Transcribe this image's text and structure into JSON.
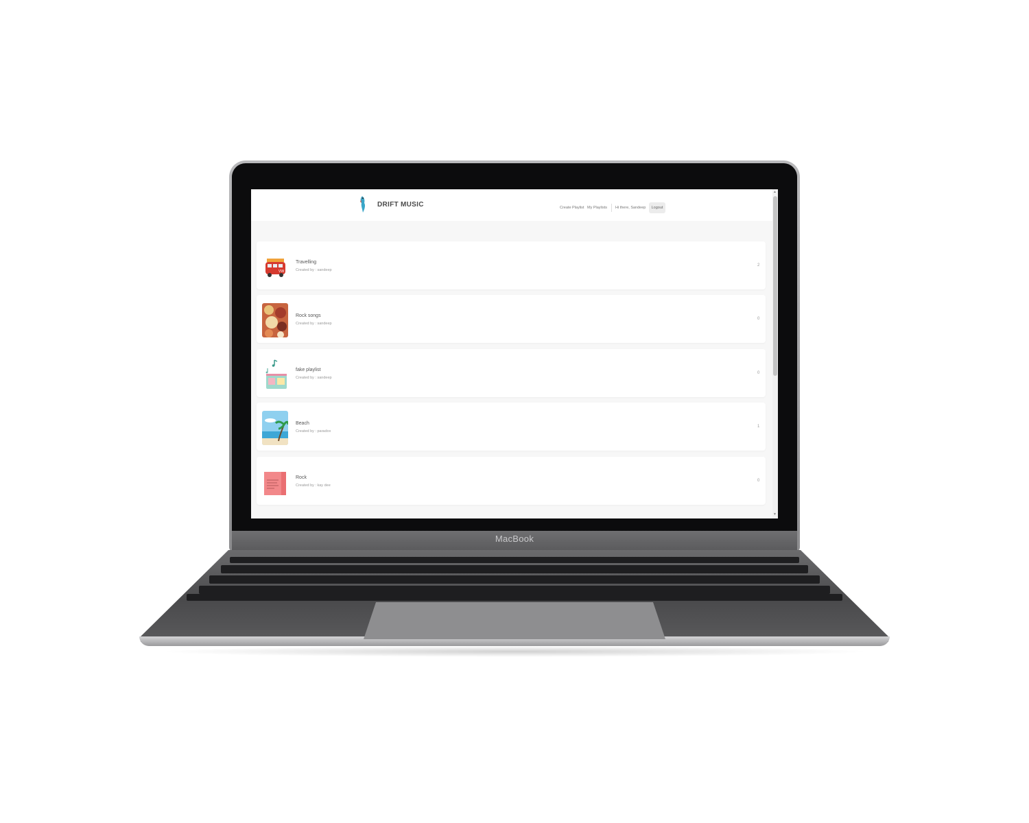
{
  "device": {
    "brand_label": "MacBook"
  },
  "app": {
    "title": "DRIFT MUSIC",
    "logo_icon": "bird-logo-icon"
  },
  "nav": {
    "create_playlist": "Create Playlist",
    "my_playlists": "My Playlists",
    "greeting": "Hi there, Sandeep",
    "logout": "Logout"
  },
  "playlists": [
    {
      "name": "Travelling",
      "created_by": "Created by : sandeep",
      "count": "2",
      "thumb": "red-van-thumbnail"
    },
    {
      "name": "Rock songs",
      "created_by": "Created by : sandeep",
      "count": "0",
      "thumb": "food-collage-thumbnail"
    },
    {
      "name": "fake playlist",
      "created_by": "Created by : sandeep",
      "count": "0",
      "thumb": "radio-music-thumbnail"
    },
    {
      "name": "Beach",
      "created_by": "Created by : paradox",
      "count": "1",
      "thumb": "beach-thumbnail"
    },
    {
      "name": "Rock",
      "created_by": "Created by : kay dee",
      "count": "0",
      "thumb": "pink-book-thumbnail"
    }
  ],
  "colors": {
    "page_bg": "#f7f7f7",
    "card_bg": "#ffffff",
    "text_primary": "#555555",
    "text_muted": "#999999"
  }
}
